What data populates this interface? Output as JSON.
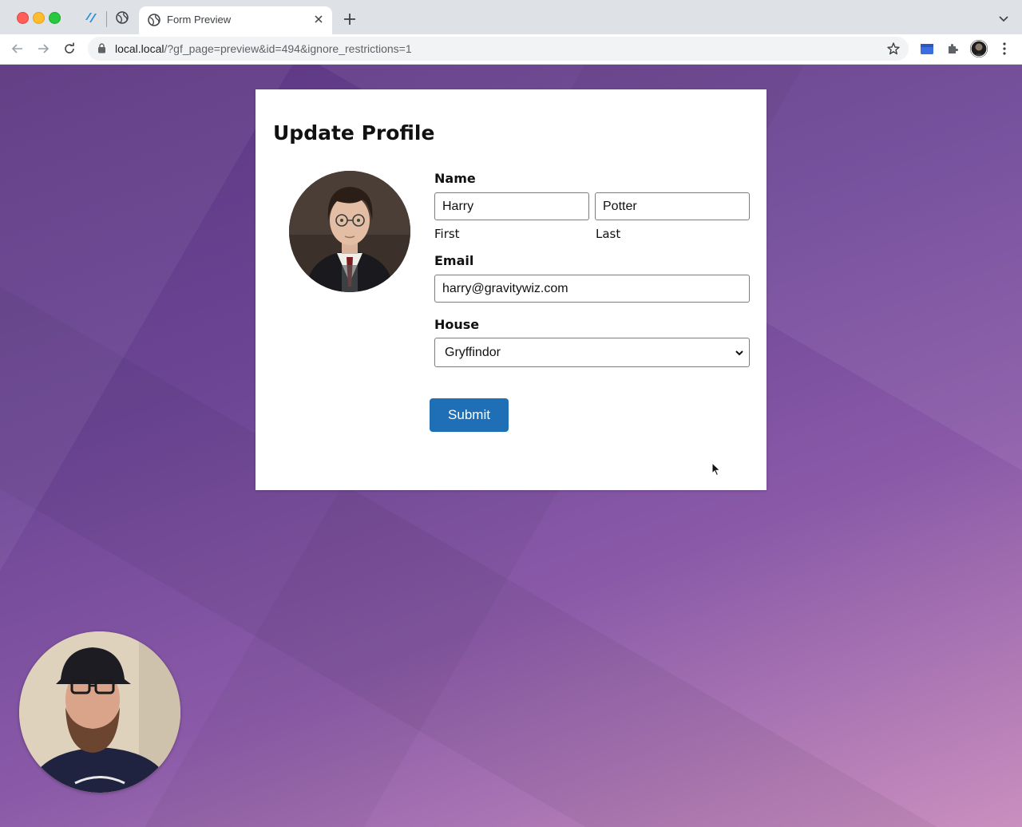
{
  "browser": {
    "active_tab_title": "Form Preview",
    "url_host": "local.local",
    "url_path": "/?gf_page=preview&id=494&ignore_restrictions=1"
  },
  "form": {
    "title": "Update Profile",
    "name_label": "Name",
    "first_value": "Harry",
    "first_sublabel": "First",
    "last_value": "Potter",
    "last_sublabel": "Last",
    "email_label": "Email",
    "email_value": "harry@gravitywiz.com",
    "house_label": "House",
    "house_selected": "Gryffindor",
    "submit_label": "Submit"
  },
  "colors": {
    "accent": "#1e6fb5",
    "background_purple": "#6c4595"
  }
}
